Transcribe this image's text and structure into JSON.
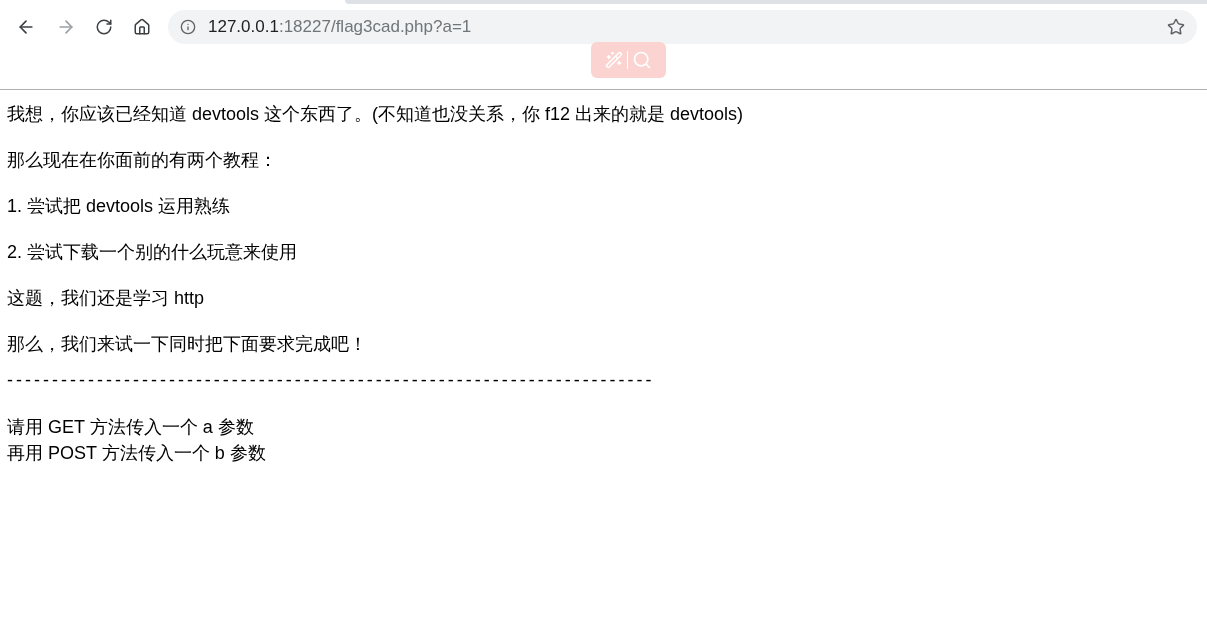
{
  "toolbar": {
    "url_host": "127.0.0.1",
    "url_rest": ":18227/flag3cad.php?a=1",
    "forward_disabled": true
  },
  "paragraphs": [
    "我想，你应该已经知道 devtools 这个东西了。(不知道也没关系，你 f12 出来的就是 devtools)",
    "那么现在在你面前的有两个教程：",
    "1. 尝试把 devtools 运用熟练",
    "2. 尝试下载一个别的什么玩意来使用",
    "这题，我们还是学习 http",
    "那么，我们来试一下同时把下面要求完成吧！"
  ],
  "separator": "------------------------------------------------------------------------",
  "instructions": [
    "请用 GET 方法传入一个 a 参数",
    "再用 POST 方法传入一个 b 参数"
  ]
}
